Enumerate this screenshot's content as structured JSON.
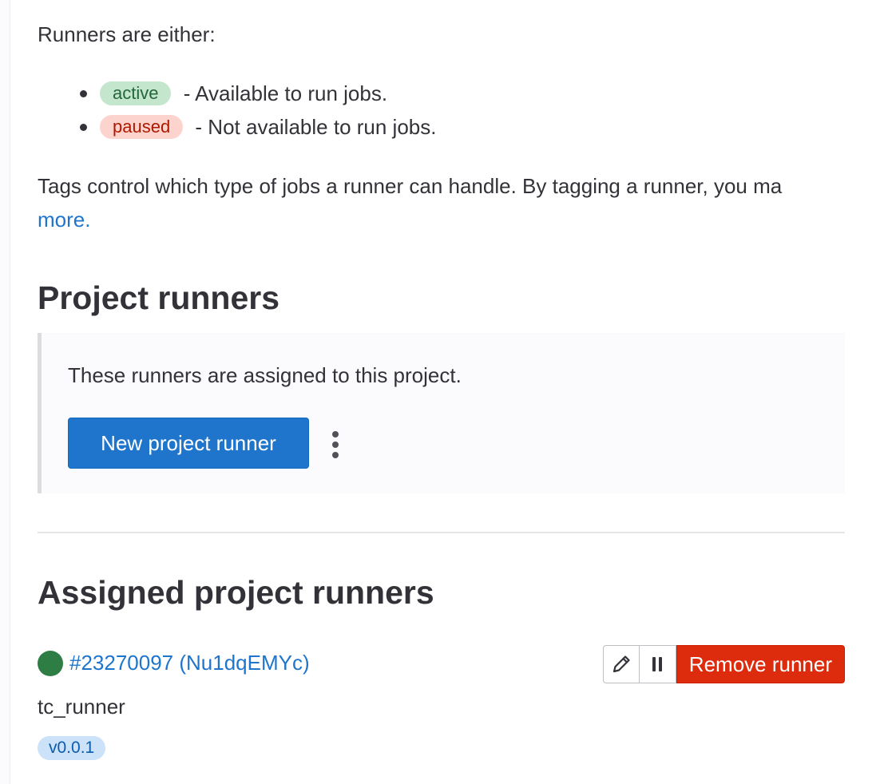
{
  "intro": {
    "text": "Runners are either:"
  },
  "statuses": [
    {
      "badge": "active",
      "description": "- Available to run jobs."
    },
    {
      "badge": "paused",
      "description": "- Not available to run jobs."
    }
  ],
  "tags_info": {
    "text": "Tags control which type of jobs a runner can handle. By tagging a runner, you ma",
    "link_text": "more."
  },
  "project_runners": {
    "title": "Project runners",
    "description": "These runners are assigned to this project.",
    "new_button_label": "New project runner",
    "more_actions_icon": "ellipsis-v-icon"
  },
  "assigned": {
    "title": "Assigned project runners",
    "runner": {
      "status_color": "#2e7d44",
      "link_text": "#23270097 (Nu1dqEMYc)",
      "description": "tc_runner",
      "version": "v0.0.1",
      "edit_icon": "pencil-icon",
      "pause_icon": "pause-icon",
      "remove_label": "Remove runner"
    }
  },
  "colors": {
    "primary": "#1f75cb",
    "danger": "#dd2b0e",
    "success_badge_bg": "#c3e6cd",
    "danger_badge_bg": "#fdd4cd",
    "info_badge_bg": "#cbe2f9"
  }
}
